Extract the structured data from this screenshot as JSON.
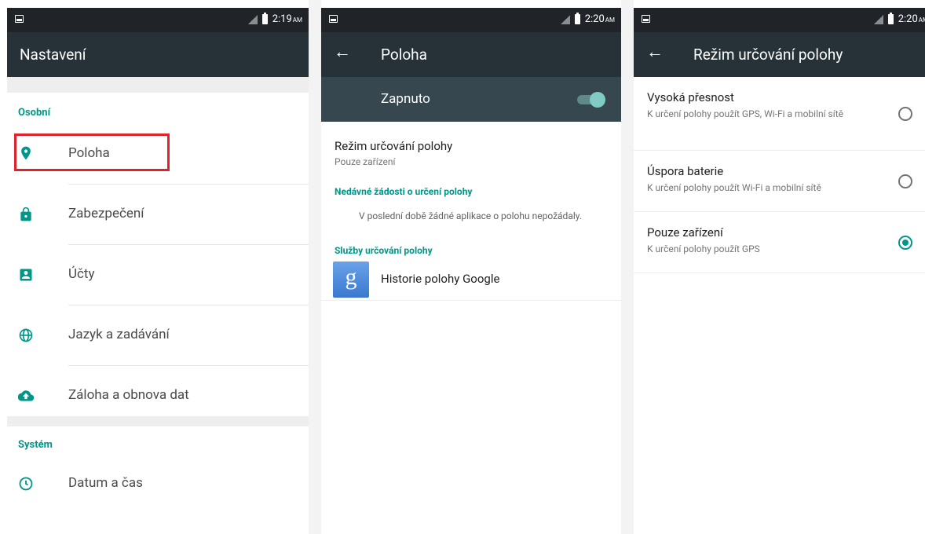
{
  "screen1": {
    "status": {
      "time": "2:19",
      "ampm": "AM"
    },
    "title": "Nastavení",
    "section_personal": "Osobní",
    "items": [
      {
        "label": "Poloha",
        "icon": "location-pin-icon"
      },
      {
        "label": "Zabezpečení",
        "icon": "lock-icon"
      },
      {
        "label": "Účty",
        "icon": "account-box-icon"
      },
      {
        "label": "Jazyk a zadávání",
        "icon": "globe-icon"
      },
      {
        "label": "Záloha a obnova dat",
        "icon": "cloud-upload-icon"
      }
    ],
    "section_system": "Systém",
    "system_items": [
      {
        "label": "Datum a čas",
        "icon": "clock-icon"
      }
    ]
  },
  "screen2": {
    "status": {
      "time": "2:20",
      "ampm": "AM"
    },
    "title": "Poloha",
    "toggle_label": "Zapnuto",
    "toggle_on": true,
    "mode": {
      "title": "Režim určování polohy",
      "subtitle": "Pouze zařízení"
    },
    "recent_header": "Nedávné žádosti o určení polohy",
    "recent_empty": "V poslední době žádné aplikace o polohu nepožádaly.",
    "services_header": "Služby určování polohy",
    "services": [
      {
        "label": "Historie polohy Google",
        "icon": "google-g-icon",
        "glyph": "g"
      }
    ]
  },
  "screen3": {
    "status": {
      "time": "2:20",
      "ampm": "AM"
    },
    "title": "Režim určování polohy",
    "options": [
      {
        "title": "Vysoká přesnost",
        "subtitle": "K určení polohy použít GPS, Wi-Fi a mobilní sítě",
        "selected": false
      },
      {
        "title": "Úspora baterie",
        "subtitle": "K určení polohy použít Wi-Fi a mobilní sítě",
        "selected": false
      },
      {
        "title": "Pouze zařízení",
        "subtitle": "K určení polohy použít GPS",
        "selected": true
      }
    ]
  },
  "colors": {
    "accent": "#009688",
    "appbar": "#263238",
    "statusbar": "#202327",
    "highlight": "#e0232b"
  }
}
